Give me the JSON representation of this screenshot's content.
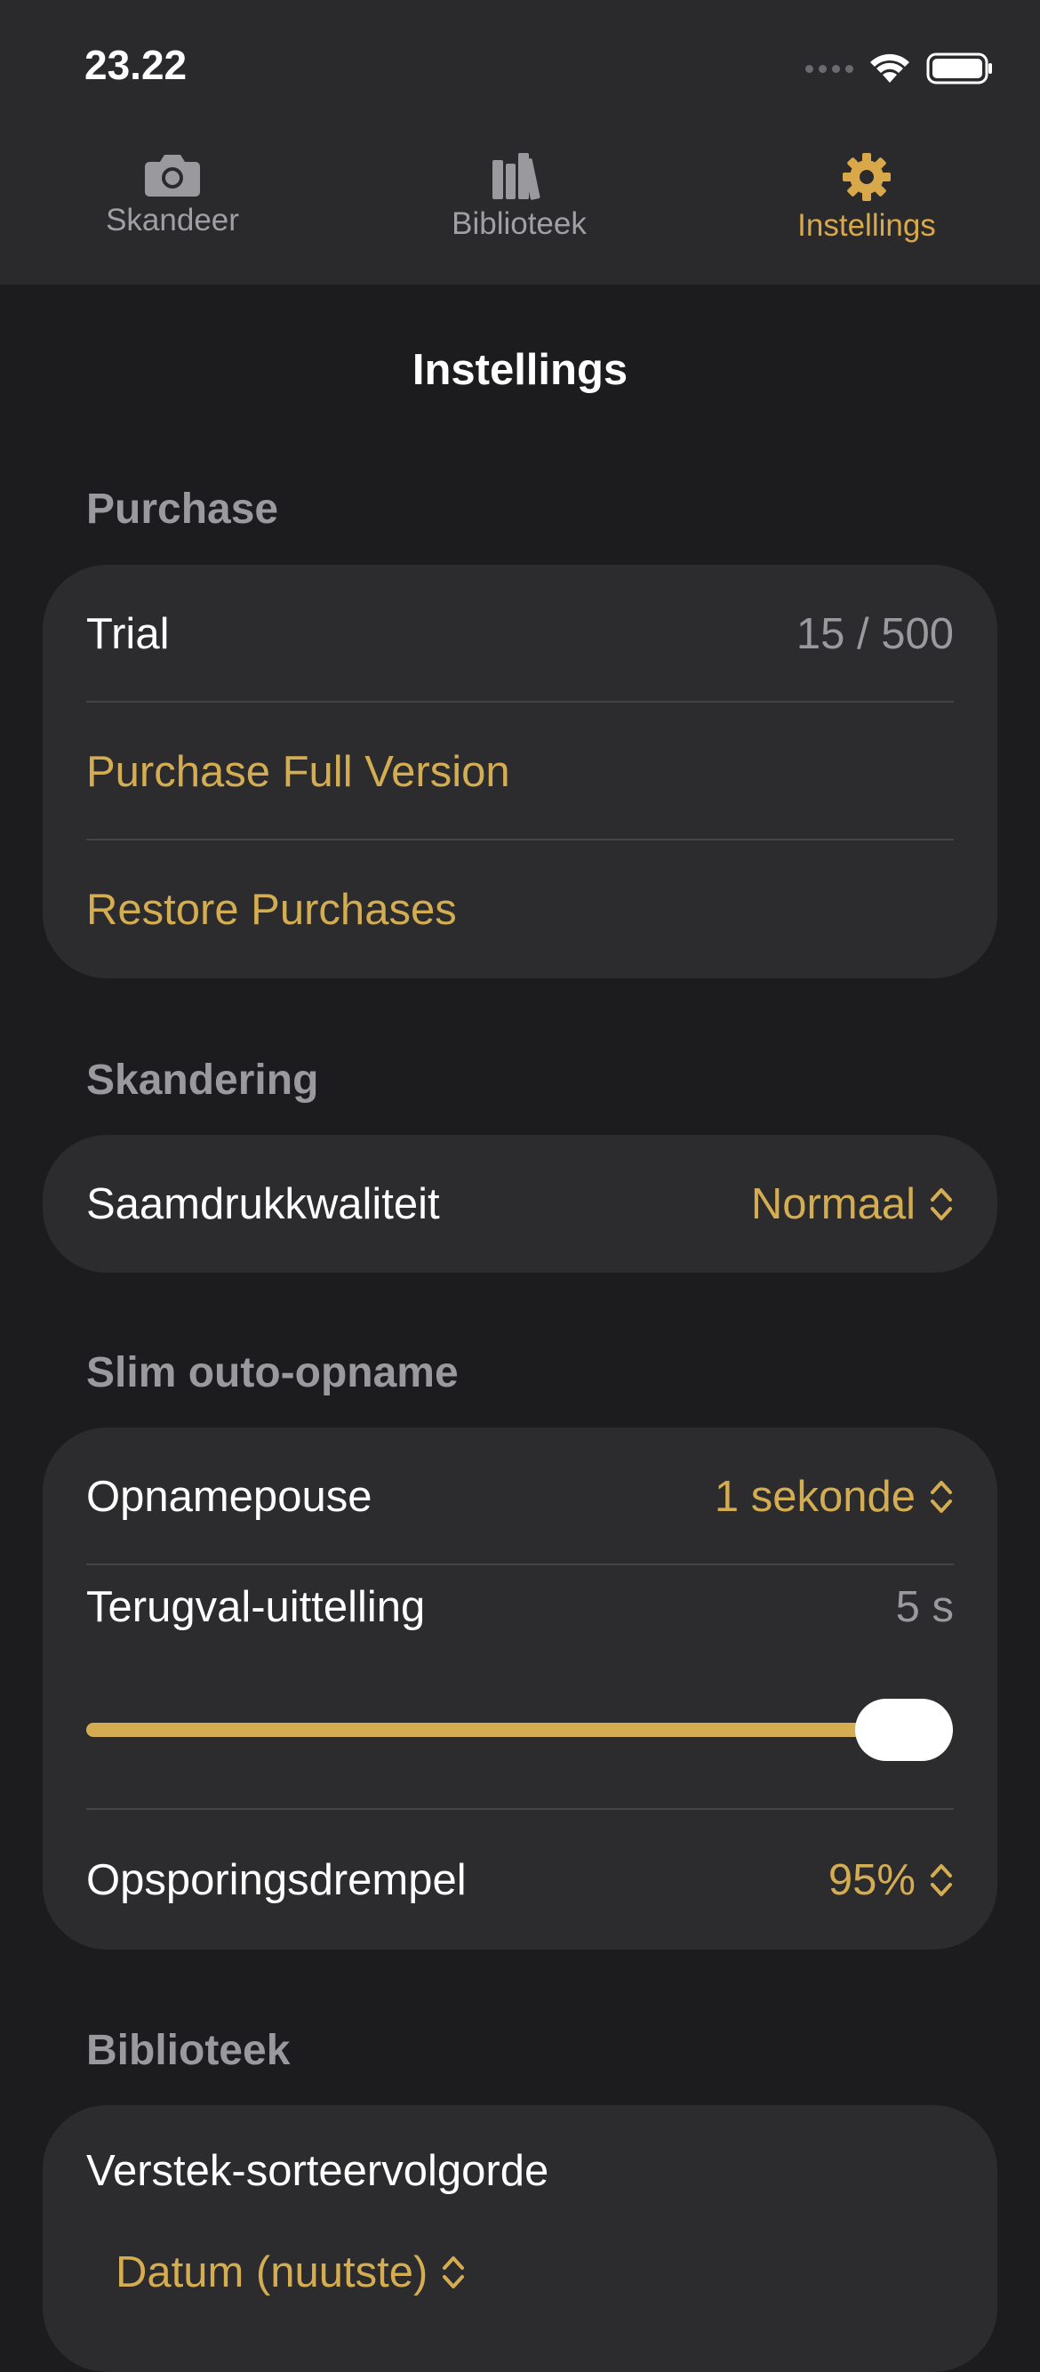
{
  "status_bar": {
    "time": "23.22"
  },
  "tabs": [
    {
      "label": "Skandeer",
      "icon": "camera-icon"
    },
    {
      "label": "Biblioteek",
      "icon": "books-icon"
    },
    {
      "label": "Instellings",
      "icon": "gear-icon",
      "active": true
    }
  ],
  "page": {
    "title": "Instellings"
  },
  "purchase": {
    "header": "Purchase",
    "trial_label": "Trial",
    "trial_value": "15 / 500",
    "purchase_full": "Purchase Full Version",
    "restore": "Restore Purchases"
  },
  "scanning": {
    "header": "Skandering",
    "quality_label": "Saamdrukkwaliteit",
    "quality_value": "Normaal"
  },
  "smart_capture": {
    "header": "Slim outo-opname",
    "pause_label": "Opnamepouse",
    "pause_value": "1 sekonde",
    "countdown_label": "Terugval-uittelling",
    "countdown_value": "5 s",
    "countdown_slider_fraction": 1.0,
    "threshold_label": "Opsporingsdrempel",
    "threshold_value": "95%"
  },
  "library": {
    "header": "Biblioteek",
    "sort_label": "Verstek-sorteervolgorde",
    "sort_value": "Datum (nuutste)"
  },
  "colors": {
    "accent": "#d4ad52",
    "background": "#1c1c1e",
    "card": "#2c2c2e"
  }
}
